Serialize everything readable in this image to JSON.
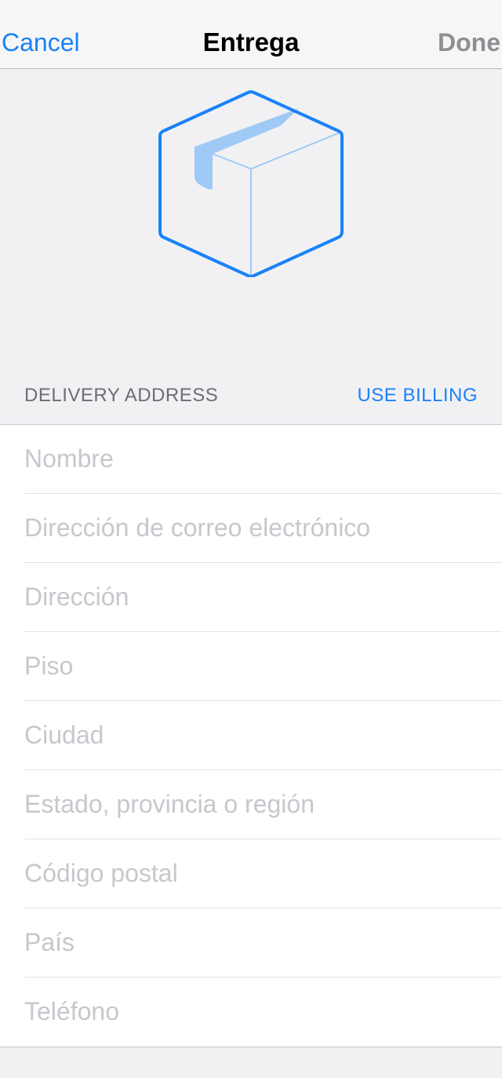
{
  "navbar": {
    "cancel_label": "Cancel",
    "title": "Entrega",
    "done_label": "Done"
  },
  "hero": {
    "icon": "package-box-icon",
    "accent_color": "#1a82f7"
  },
  "section": {
    "title": "DELIVERY ADDRESS",
    "action_label": "USE BILLING"
  },
  "form": {
    "fields": [
      {
        "placeholder": "Nombre",
        "value": ""
      },
      {
        "placeholder": "Dirección de correo electrónico",
        "value": ""
      },
      {
        "placeholder": "Dirección",
        "value": ""
      },
      {
        "placeholder": "Piso",
        "value": ""
      },
      {
        "placeholder": "Ciudad",
        "value": ""
      },
      {
        "placeholder": "Estado, provincia o región",
        "value": ""
      },
      {
        "placeholder": "Código postal",
        "value": ""
      },
      {
        "placeholder": "País",
        "value": ""
      },
      {
        "placeholder": "Teléfono",
        "value": ""
      }
    ]
  }
}
